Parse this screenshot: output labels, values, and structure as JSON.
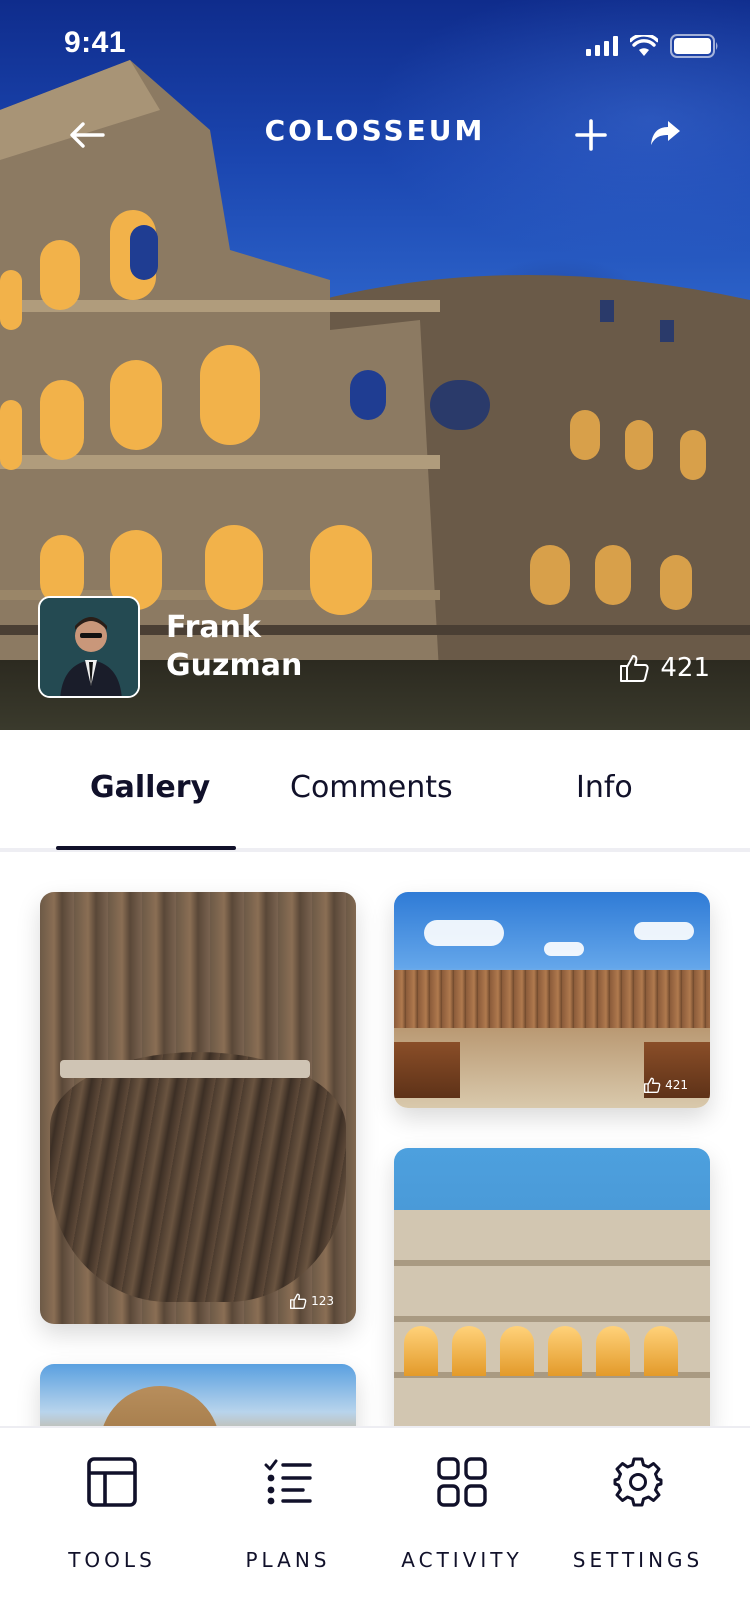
{
  "status_bar": {
    "time": "9:41"
  },
  "header": {
    "title": "COLOSSEUM"
  },
  "author": {
    "name_first": "Frank",
    "name_last": "Guzman"
  },
  "post": {
    "likes": "421"
  },
  "tabs": [
    {
      "label": "Gallery",
      "active": true
    },
    {
      "label": "Comments",
      "active": false
    },
    {
      "label": "Info",
      "active": false
    }
  ],
  "gallery": [
    {
      "likes": "123"
    },
    {
      "likes": "421"
    }
  ],
  "bottom_nav": [
    {
      "label": "TOOLS",
      "icon": "layout-icon"
    },
    {
      "label": "PLANS",
      "icon": "checklist-icon"
    },
    {
      "label": "ACTIVITY",
      "icon": "grid-icon"
    },
    {
      "label": "SETTINGS",
      "icon": "gear-icon"
    }
  ],
  "colors": {
    "accent": "#11112a",
    "text": "#11112a",
    "divider": "#eeeef3",
    "hero_sky": "#1b46b0"
  }
}
